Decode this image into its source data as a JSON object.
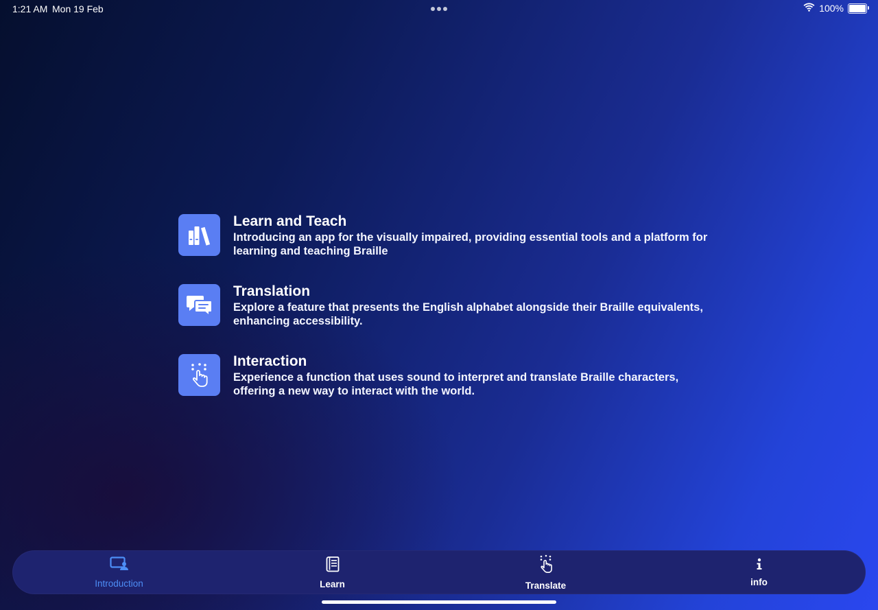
{
  "status_bar": {
    "time": "1:21 AM",
    "date": "Mon 19 Feb",
    "battery_percent": "100%",
    "battery_level": 1.0
  },
  "features": [
    {
      "icon": "books-icon",
      "title": "Learn and Teach",
      "description": "Introducing an app for the visually impaired, providing essential tools and a platform for learning and teaching Braille"
    },
    {
      "icon": "speech-bubbles-icon",
      "title": "Translation",
      "description": "Explore a feature that presents the English alphabet alongside their Braille equivalents, enhancing accessibility."
    },
    {
      "icon": "hand-braille-icon",
      "title": "Interaction",
      "description": "Experience a function that uses sound to interpret and translate Braille characters, offering a new way to interact with the world."
    }
  ],
  "tab_bar": {
    "tabs": [
      {
        "label": "Introduction",
        "icon": "introduction-icon",
        "active": true
      },
      {
        "label": "Learn",
        "icon": "book-icon",
        "active": false
      },
      {
        "label": "Translate",
        "icon": "hand-tap-icon",
        "active": false
      },
      {
        "label": "info",
        "icon": "info-icon",
        "active": false
      }
    ]
  },
  "colors": {
    "accent": "#4d8ef7",
    "icon_tile": "#5a7ef3",
    "tab_bar_bg": "#1e236f"
  }
}
